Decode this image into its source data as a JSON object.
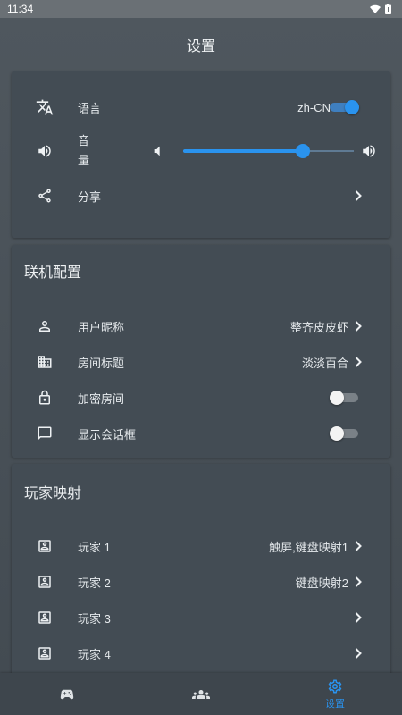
{
  "status": {
    "time": "11:34"
  },
  "page": {
    "title": "设置"
  },
  "general": {
    "language_label": "语言",
    "language_value": "zh-CN",
    "language_toggle_on": true,
    "volume_label": "音量",
    "volume_level": 0.7,
    "share_label": "分享"
  },
  "online": {
    "header": "联机配置",
    "nickname_label": "用户昵称",
    "nickname_value": "整齐皮皮虾",
    "room_title_label": "房间标题",
    "room_title_value": "淡淡百合",
    "encrypt_label": "加密房间",
    "encrypt_on": false,
    "dialog_label": "显示会话框",
    "dialog_on": false
  },
  "players": {
    "header": "玩家映射",
    "items": [
      {
        "label": "玩家 1",
        "value": "触屏,键盘映射1"
      },
      {
        "label": "玩家 2",
        "value": "键盘映射2"
      },
      {
        "label": "玩家 3",
        "value": ""
      },
      {
        "label": "玩家 4",
        "value": ""
      }
    ]
  },
  "nav": {
    "settings_label": "设置"
  },
  "colors": {
    "accent": "#2a93ee",
    "background": "#4a5259",
    "card": "#434c54"
  }
}
